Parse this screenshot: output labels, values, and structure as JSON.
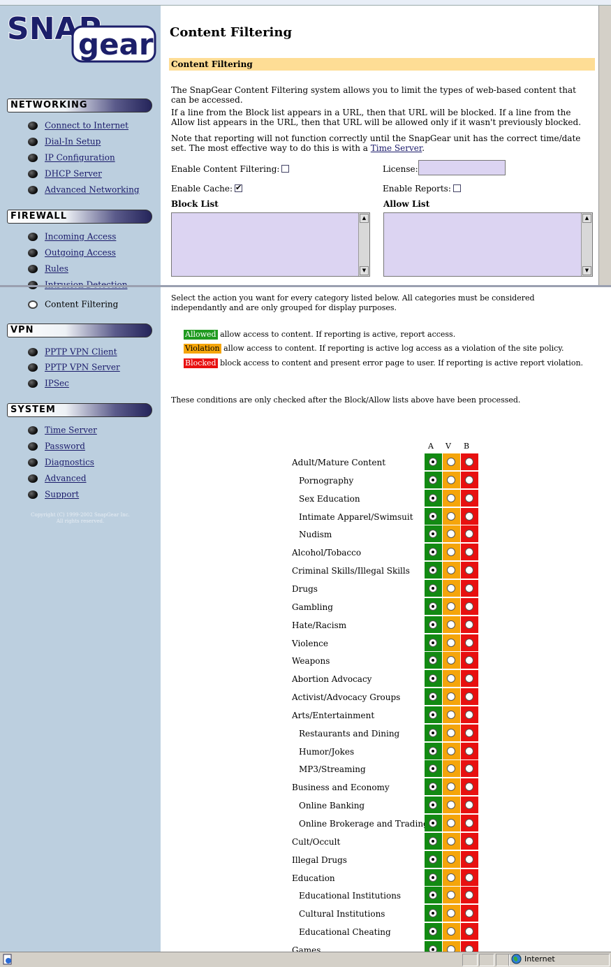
{
  "sidebar": {
    "logo_top": "SNAP",
    "logo_bottom": "gear",
    "sections": [
      {
        "title": "NETWORKING",
        "items": [
          "Connect to Internet",
          "Dial-In Setup",
          "IP Configuration",
          "DHCP Server",
          "Advanced Networking"
        ]
      },
      {
        "title": "FIREWALL",
        "items": [
          "Incoming Access",
          "Outgoing Access",
          "Rules",
          "Intrusion Detection",
          "Content Filtering"
        ]
      },
      {
        "title": "VPN",
        "items": [
          "PPTP VPN Client",
          "PPTP VPN Server",
          "IPSec"
        ]
      },
      {
        "title": "SYSTEM",
        "items": [
          "Time Server",
          "Password",
          "Diagnostics",
          "Advanced",
          "Support"
        ]
      }
    ],
    "copyright_line1": "Copyright (C) 1999-2002 SnapGear Inc.",
    "copyright_line2": "All rights reserved."
  },
  "main": {
    "title": "Content Filtering",
    "section_bar": "Content Filtering",
    "intro1": "The SnapGear Content Filtering system allows you to limit the types of web-based content that can be accessed.",
    "intro2": "If a line from the Block list appears in a URL, then that URL will be blocked. If a line from the Allow list appears in the URL, then that URL will be allowed only if it wasn't previously blocked.",
    "intro3_prefix": "Note that reporting will not function correctly until the SnapGear unit has the correct time/date set. The most effective way to do this is with a",
    "intro3_link": "Time Server",
    "intro3_suffix": ".",
    "enable_filtering_label": "Enable Content Filtering:",
    "enable_filtering": false,
    "license_label": "License:",
    "license_value": "",
    "enable_cache_label": "Enable Cache:",
    "enable_cache": true,
    "enable_reports_label": "Enable Reports:",
    "enable_reports": false,
    "block_list_label": "Block List",
    "allow_list_label": "Allow List",
    "select_action_text": "Select the action you want for every category listed below. All categories must be considered independantly and are only grouped for display purposes.",
    "legend": [
      {
        "key": "Allowed",
        "text": "allow access to content. If reporting is active, report access."
      },
      {
        "key": "Violation",
        "text": "allow access to content. If reporting is active log access as a violation of the site policy."
      },
      {
        "key": "Blocked",
        "text": "block access to content and present error page to user. If reporting is active report violation."
      }
    ],
    "conditions_text": "These conditions are only checked after the Block/Allow lists above have been processed.",
    "columns": [
      "A",
      "V",
      "B"
    ]
  },
  "categories": [
    {
      "name": "Adult/Mature Content",
      "sub": false,
      "selected": "A"
    },
    {
      "name": "Pornography",
      "sub": true,
      "selected": "A"
    },
    {
      "name": "Sex Education",
      "sub": true,
      "selected": "A"
    },
    {
      "name": "Intimate Apparel/Swimsuit",
      "sub": true,
      "selected": "A"
    },
    {
      "name": "Nudism",
      "sub": true,
      "selected": "A"
    },
    {
      "name": "Alcohol/Tobacco",
      "sub": false,
      "selected": "A"
    },
    {
      "name": "Criminal Skills/Illegal Skills",
      "sub": false,
      "selected": "A"
    },
    {
      "name": "Drugs",
      "sub": false,
      "selected": "A"
    },
    {
      "name": "Gambling",
      "sub": false,
      "selected": "A"
    },
    {
      "name": "Hate/Racism",
      "sub": false,
      "selected": "A"
    },
    {
      "name": "Violence",
      "sub": false,
      "selected": "A"
    },
    {
      "name": "Weapons",
      "sub": false,
      "selected": "A"
    },
    {
      "name": "Abortion Advocacy",
      "sub": false,
      "selected": "A"
    },
    {
      "name": "Activist/Advocacy Groups",
      "sub": false,
      "selected": "A"
    },
    {
      "name": "Arts/Entertainment",
      "sub": false,
      "selected": "A"
    },
    {
      "name": "Restaurants and Dining",
      "sub": true,
      "selected": "A"
    },
    {
      "name": "Humor/Jokes",
      "sub": true,
      "selected": "A"
    },
    {
      "name": "MP3/Streaming",
      "sub": true,
      "selected": "A"
    },
    {
      "name": "Business and Economy",
      "sub": false,
      "selected": "A"
    },
    {
      "name": "Online Banking",
      "sub": true,
      "selected": "A"
    },
    {
      "name": "Online Brokerage and Trading",
      "sub": true,
      "selected": "A"
    },
    {
      "name": "Cult/Occult",
      "sub": false,
      "selected": "A"
    },
    {
      "name": "Illegal Drugs",
      "sub": false,
      "selected": "A"
    },
    {
      "name": "Education",
      "sub": false,
      "selected": "A"
    },
    {
      "name": "Educational Institutions",
      "sub": true,
      "selected": "A"
    },
    {
      "name": "Cultural Institutions",
      "sub": true,
      "selected": "A"
    },
    {
      "name": "Educational Cheating",
      "sub": true,
      "selected": "A"
    },
    {
      "name": "Games",
      "sub": false,
      "selected": "A"
    }
  ],
  "statusbar": {
    "zone": "Internet"
  }
}
